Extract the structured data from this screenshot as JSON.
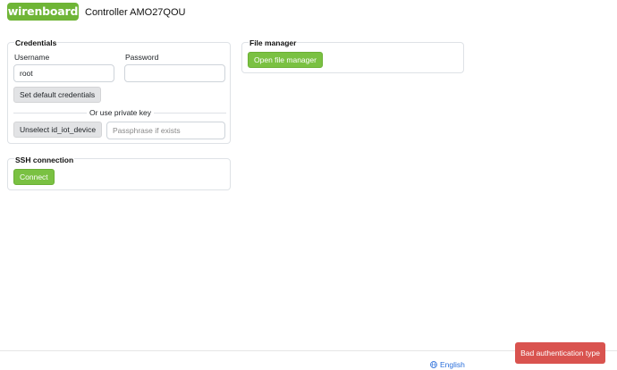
{
  "header": {
    "logo_text": "wirenboard",
    "title": "Controller AMO27QOU"
  },
  "credentials": {
    "title": "Credentials",
    "username_label": "Username",
    "username_value": "root",
    "password_label": "Password",
    "password_value": "",
    "set_default_label": "Set default credentials",
    "divider_text": "Or use private key",
    "unselect_key_label": "Unselect id_iot_device",
    "passphrase_placeholder": "Passphrase if exists"
  },
  "ssh": {
    "title": "SSH connection",
    "connect_label": "Connect"
  },
  "file_manager": {
    "title": "File manager",
    "open_label": "Open file manager"
  },
  "footer": {
    "language_label": "English",
    "language_icon": "globe-icon"
  },
  "toast": {
    "message": "Bad authentication type"
  },
  "colors": {
    "brand_green": "#6fb536",
    "button_green": "#7ac142",
    "error_red": "#d9534f",
    "link_blue": "#2a6fdb"
  }
}
